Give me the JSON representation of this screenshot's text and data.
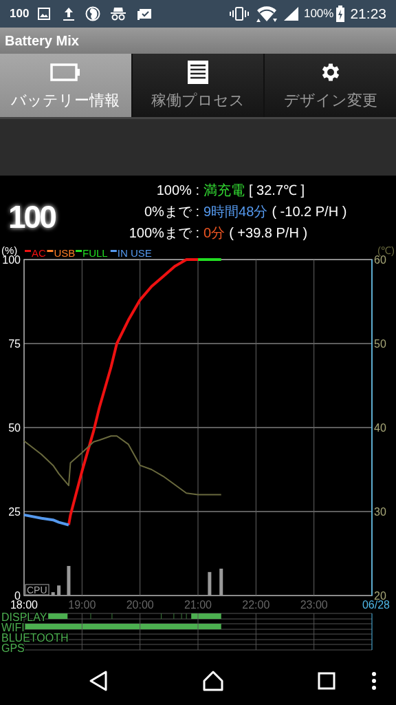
{
  "status_bar": {
    "notification_text": "100",
    "battery": "100%",
    "time": "21:23"
  },
  "app_title": "Battery Mix",
  "tabs": [
    {
      "label": "バッテリー情報",
      "selected": true,
      "kind": "battery"
    },
    {
      "label": "稼働プロセス",
      "selected": false,
      "kind": "list"
    },
    {
      "label": "デザイン変更",
      "selected": false,
      "kind": "gear"
    }
  ],
  "summary": {
    "big_number": "100",
    "rows": [
      {
        "label": "100% :",
        "value": "満充電",
        "detail": "[ 32.7℃ ]",
        "color": "#33dd33"
      },
      {
        "label": "0%まで :",
        "value": "9時間48分",
        "detail": "( -10.2 P/H )",
        "color": "#5599ee"
      },
      {
        "label": "100%まで :",
        "value": "0分",
        "detail": "( +39.8 P/H )",
        "color": "#ee5522"
      }
    ]
  },
  "chart_data": {
    "type": "line",
    "ylabel": "(%)",
    "grid": true,
    "legend": "top",
    "xlim": [
      18,
      24
    ],
    "ylim": [
      0,
      100
    ],
    "y2lim": [
      20,
      60
    ],
    "x": [
      18.0,
      18.3,
      18.5,
      18.6,
      18.77,
      18.8,
      19.0,
      19.2,
      19.3,
      19.5,
      19.6,
      19.8,
      20.0,
      20.2,
      20.4,
      20.6,
      20.8,
      21.0,
      21.2,
      21.4
    ],
    "xticks": [
      {
        "value": 18,
        "label": "18:00"
      },
      {
        "value": 19,
        "label": "19:00"
      },
      {
        "value": 20,
        "label": "20:00"
      },
      {
        "value": 21,
        "label": "21:00"
      },
      {
        "value": 22,
        "label": "22:00"
      },
      {
        "value": 23,
        "label": "23:00"
      },
      {
        "value": 24,
        "label": "06/28"
      }
    ],
    "yticks": [
      0,
      25,
      50,
      75,
      100
    ],
    "y2ticks": [
      20,
      30,
      40,
      50,
      60
    ],
    "series": [
      {
        "name": "AC",
        "color": "#ee1111",
        "values": [
          null,
          null,
          null,
          null,
          21,
          24,
          37,
          49,
          56,
          68,
          75,
          82,
          88,
          92,
          95,
          98,
          100,
          100,
          null,
          null
        ]
      },
      {
        "name": "USB",
        "color": "#ff7f27",
        "values": [
          null,
          null,
          null,
          null,
          null,
          null,
          null,
          null,
          null,
          null,
          null,
          null,
          null,
          null,
          null,
          null,
          null,
          null,
          null,
          null
        ]
      },
      {
        "name": "FULL",
        "color": "#22dd22",
        "values": [
          null,
          null,
          null,
          null,
          null,
          null,
          null,
          null,
          null,
          null,
          null,
          null,
          null,
          null,
          null,
          null,
          null,
          100,
          100,
          100
        ]
      },
      {
        "name": "IN USE",
        "color": "#5599ee",
        "values": [
          24,
          23,
          22.5,
          21.8,
          21,
          null,
          null,
          null,
          null,
          null,
          null,
          null,
          null,
          null,
          null,
          null,
          null,
          null,
          null,
          null
        ]
      },
      {
        "name": "(℃)",
        "axis": "y2",
        "color": "#6a6a3e",
        "values": [
          38.4,
          36.8,
          35.5,
          34.5,
          33.1,
          35.8,
          37,
          38.3,
          38.5,
          39,
          39,
          38,
          35.5,
          35,
          34.2,
          33.2,
          32.2,
          32,
          32,
          32
        ]
      },
      {
        "name": "CPU",
        "type": "bar",
        "color": "#999999",
        "values": [
          null,
          null,
          1,
          3,
          8.8,
          null,
          null,
          null,
          null,
          null,
          null,
          null,
          null,
          null,
          null,
          null,
          null,
          null,
          7,
          8
        ]
      }
    ]
  },
  "activity": [
    {
      "label": "DISPLAY"
    },
    {
      "label": "WIFI"
    },
    {
      "label": "BLUETOOTH"
    },
    {
      "label": "GPS"
    }
  ]
}
